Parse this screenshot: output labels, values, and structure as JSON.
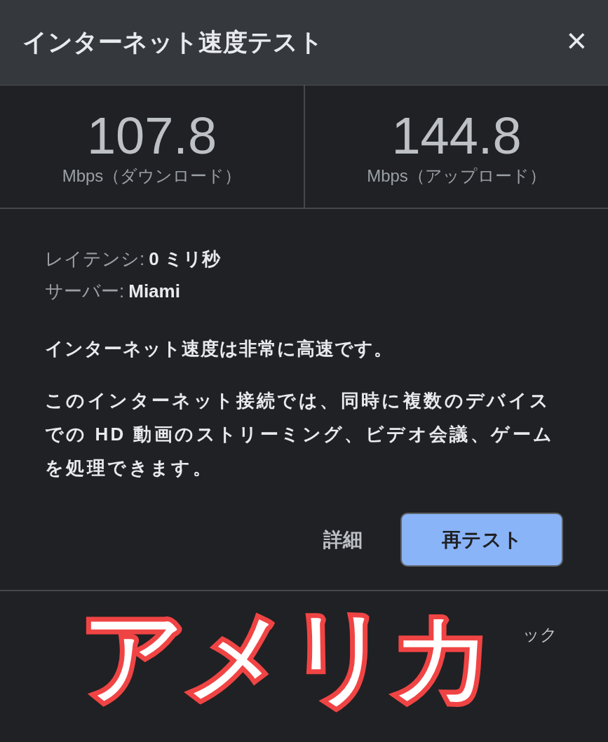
{
  "dialog": {
    "title": "インターネット速度テスト",
    "close": "×"
  },
  "results": [
    {
      "value": "107.8",
      "unit": "Mbps（ダウンロード）"
    },
    {
      "value": "144.8",
      "unit": "Mbps（アップロード）"
    }
  ],
  "details": [
    {
      "label": "レイテンシ:",
      "value": "0 ミリ秒"
    },
    {
      "label": "サーバー:",
      "value": "Miami"
    }
  ],
  "summary": "インターネット速度は非常に高速です。",
  "description": "このインターネット接続では、同時に複数のデバイスでの HD 動画のストリーミング、ビデオ会議、ゲームを処理できます。",
  "buttons": [
    {
      "label": "詳細",
      "kind": "text"
    },
    {
      "label": "再テスト",
      "kind": "primary"
    }
  ],
  "footer": {
    "link": "ック"
  },
  "overlay_caption": "アメリカ"
}
